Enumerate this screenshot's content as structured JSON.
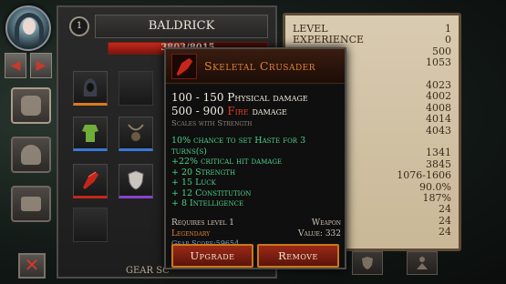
{
  "character": {
    "level": "1",
    "name": "BALDRICK",
    "hp_text": "3803/8015",
    "hp_fraction": 0.475,
    "gear_score_label": "GEAR SC"
  },
  "nav": {
    "prev": "◀",
    "next": "▶"
  },
  "rail": {
    "tabs": [
      "equipment",
      "inventory",
      "crafting"
    ],
    "close": "✕"
  },
  "slots": [
    {
      "name": "hood",
      "color": "#d97a1e"
    },
    {
      "name": "empty",
      "color": ""
    },
    {
      "name": "armor",
      "color": "#3a78d6"
    },
    {
      "name": "amulet",
      "color": "#3a78d6"
    },
    {
      "name": "weapon",
      "color": "#c6261a"
    },
    {
      "name": "shield",
      "color": "#8a43c9"
    },
    {
      "name": "empty",
      "color": ""
    }
  ],
  "stats": {
    "rows": [
      {
        "k": "LEVEL",
        "v": "1"
      },
      {
        "k": "EXPERIENCE",
        "v": "0"
      },
      {
        "k": "",
        "v": "500"
      },
      {
        "k": "",
        "v": "1053"
      },
      {
        "k": "",
        "v": ""
      },
      {
        "k": "",
        "v": "4023"
      },
      {
        "k": "",
        "v": "4002"
      },
      {
        "k": "",
        "v": "4008"
      },
      {
        "k": "",
        "v": "4014"
      },
      {
        "k": "",
        "v": "4043"
      },
      {
        "k": "",
        "v": ""
      },
      {
        "k": "",
        "v": "1341"
      },
      {
        "k": "",
        "v": "3845"
      },
      {
        "k": "DAMAGE",
        "v": "1076-1606"
      },
      {
        "k": "CHANCE",
        "v": "90.0%"
      },
      {
        "k": "DAMAGE",
        "v": "187%"
      },
      {
        "k": "",
        "v": "24"
      },
      {
        "k": "",
        "v": "24"
      },
      {
        "k": "",
        "v": "24"
      }
    ]
  },
  "tooltip": {
    "title": "Skeletal Crusader",
    "phys_damage": "100 - 150 Physical damage",
    "fire_damage_range": "500 - 900 ",
    "fire_word": "Fire",
    "fire_suffix": " damage",
    "scales": "Scales with Strength",
    "bonuses": [
      "10% chance to set Haste for 3 turns(s)",
      "+22% critical hit damage",
      "+ 20 Strength",
      "+ 15 Luck",
      "+ 12 Constitution",
      "+ 8 Intelligence"
    ],
    "requires": "Requires level 1",
    "item_type": "Weapon",
    "rarity": "Legendary",
    "value": "Value: 332",
    "gear_score": "Gear Score:59654",
    "upgrade_label": "Upgrade",
    "remove_label": "Remove",
    "rarity_color": "#e0833a",
    "fire_color": "#e23a22",
    "bonus_color": "#4fd08a"
  }
}
